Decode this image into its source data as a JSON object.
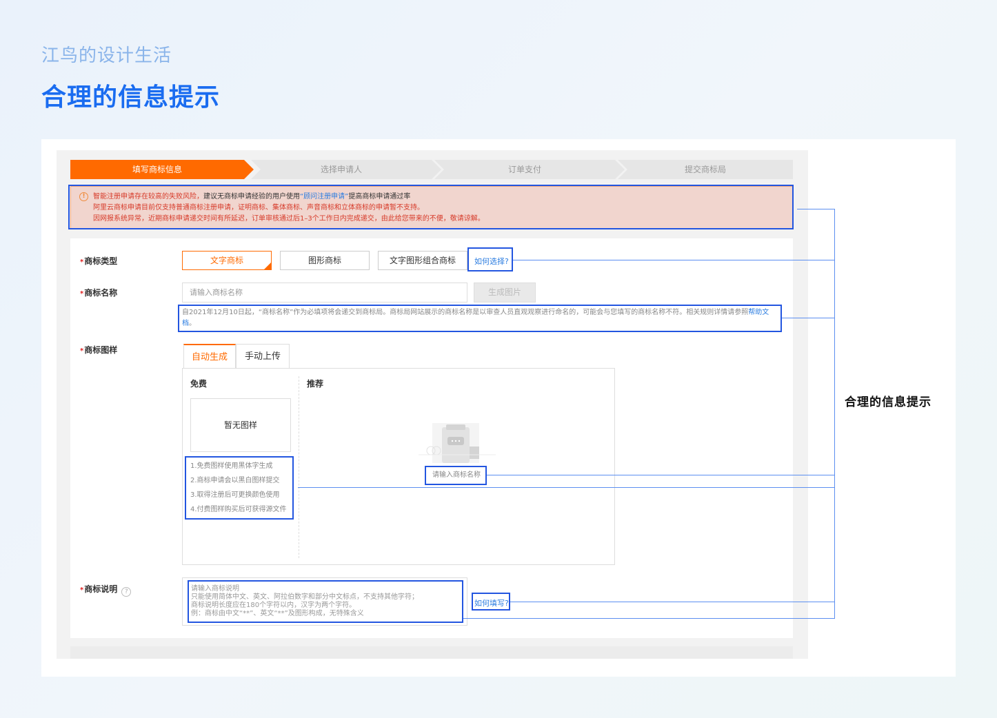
{
  "page": {
    "subtitle": "江鸟的设计生活",
    "title": "合理的信息提示",
    "annotation_label": "合理的信息提示"
  },
  "steps": [
    {
      "label": "填写商标信息",
      "active": true
    },
    {
      "label": "选择申请人",
      "active": false
    },
    {
      "label": "订单支付",
      "active": false
    },
    {
      "label": "提交商标局",
      "active": false
    }
  ],
  "alert": {
    "line1_prefix": "智能注册申请存在较高的失败风险，",
    "line1_mid": "建议无商标申请经验的用户使用",
    "line1_link": "“顾问注册申请”",
    "line1_suffix": "提高商标申请通过率",
    "line2": "阿里云商标申请目前仅支持普通商标注册申请，证明商标、集体商标、声音商标和立体商标的申请暂不支持。",
    "line3": "因网报系统异常，近期商标申请递交时间有所延迟，订单审核通过后1–3个工作日内完成递交，由此给您带来的不便，敬请谅解。"
  },
  "form": {
    "type": {
      "label": "商标类型",
      "options": [
        "文字商标",
        "图形商标",
        "文字图形组合商标"
      ],
      "selected": "文字商标",
      "help_link": "如何选择?"
    },
    "name": {
      "label": "商标名称",
      "placeholder": "请输入商标名称",
      "generate_button": "生成图片",
      "note": "自2021年12月10日起，“商标名称”作为必填项将会递交到商标局。商标局网站展示的商标名称是以审查人员直观观察进行命名的，可能会与您填写的商标名称不符。相关规则详情请参照",
      "note_link": "帮助文档",
      "note_end": "。"
    },
    "image": {
      "label": "商标图样",
      "tabs": [
        "自动生成",
        "手动上传"
      ],
      "active_tab": "自动生成",
      "free_title": "免费",
      "recommend_title": "推荐",
      "empty_text": "暂无图样",
      "free_rules": [
        "1.免费图样使用黑体字生成",
        "2.商标申请会以黑白图样提交",
        "3.取得注册后可更换颜色使用",
        "4.付费图样购买后可获得源文件"
      ],
      "recommend_placeholder": "请输入商标名称"
    },
    "description": {
      "label": "商标说明",
      "placeholder_lines": [
        "请输入商标说明",
        "只能使用简体中文、英文、阿拉伯数字和部分中文标点，不支持其他字符；",
        "商标说明长度应在180个字符以内，汉字为两个字符。",
        "例：商标由中文“**”、英文“**”及图形构成，无特殊含义"
      ],
      "help_link": "如何填写?"
    }
  },
  "colors": {
    "brand_orange": "#ff6a00",
    "annotation_blue": "#2255e0",
    "title_blue": "#1a6cf0",
    "link_blue": "#2a7ce0",
    "alert_red": "#d73b2a"
  }
}
